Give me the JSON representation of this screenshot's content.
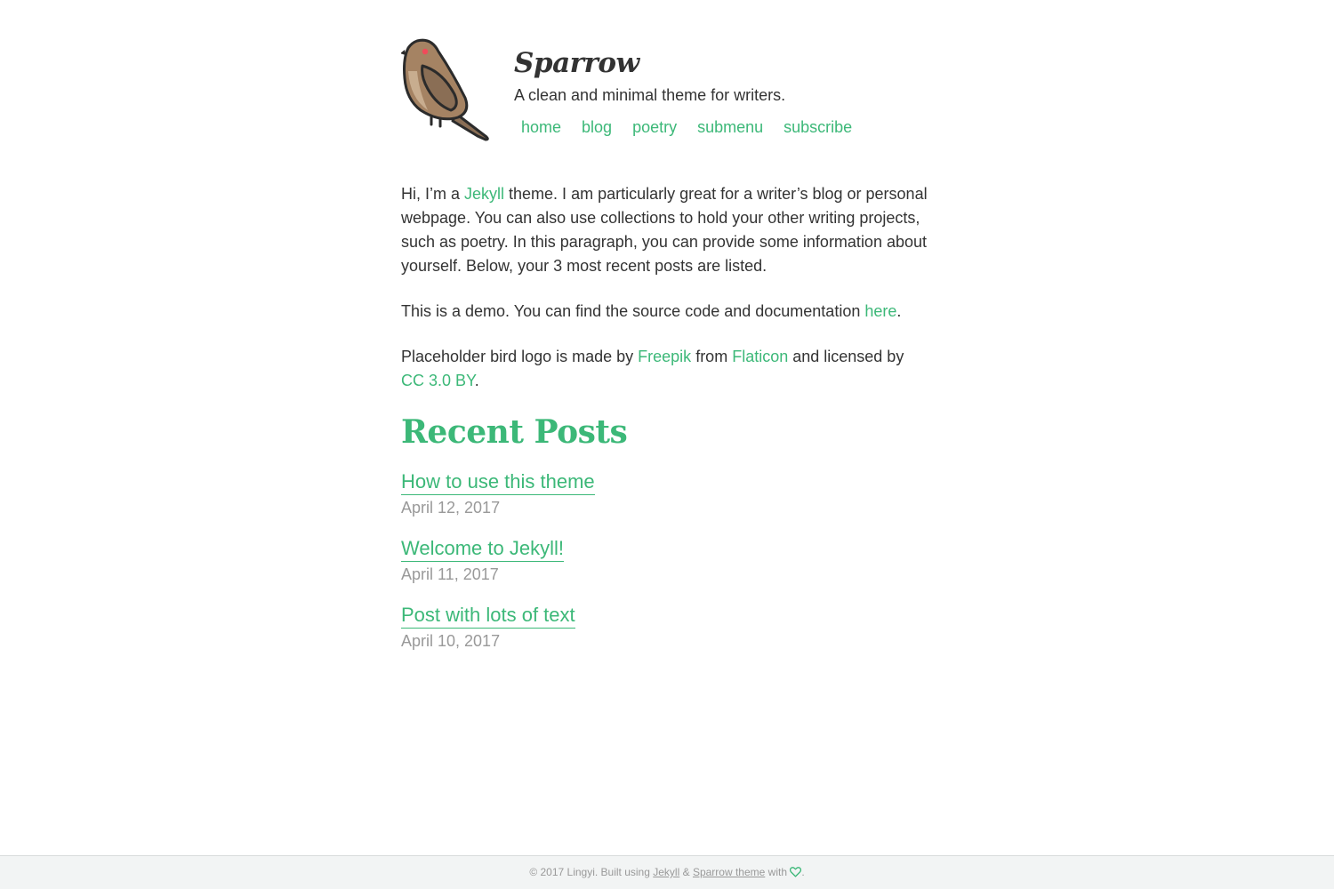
{
  "header": {
    "title": "Sparrow",
    "description": "A clean and minimal theme for writers.",
    "logo_icon": "sparrow-bird-icon",
    "nav": [
      {
        "label": "home"
      },
      {
        "label": "blog"
      },
      {
        "label": "poetry"
      },
      {
        "label": "submenu"
      },
      {
        "label": "subscribe"
      }
    ]
  },
  "intro": {
    "p1_pre": "Hi, I’m a ",
    "p1_link": "Jekyll",
    "p1_post": " theme. I am particularly great for a writer’s blog or personal webpage. You can also use collections to hold your other writing projects, such as poetry. In this paragraph, you can provide some information about yourself. Below, your 3 most recent posts are listed.",
    "p2_pre": "This is a demo. You can find the source code and documentation ",
    "p2_link": "here",
    "p2_post": ".",
    "p3_pre": "Placeholder bird logo is made by ",
    "p3_link1": "Freepik",
    "p3_mid1": " from ",
    "p3_link2": "Flaticon",
    "p3_mid2": " and licensed by ",
    "p3_link3": "CC 3.0 BY",
    "p3_post": "."
  },
  "recent": {
    "heading": "Recent Posts",
    "posts": [
      {
        "title": "How to use this theme",
        "date": "April 12, 2017"
      },
      {
        "title": "Welcome to Jekyll!",
        "date": "April 11, 2017"
      },
      {
        "title": "Post with lots of text",
        "date": "April 10, 2017"
      }
    ]
  },
  "footer": {
    "pre": "© 2017 Lingyi. Built using ",
    "link1": "Jekyll",
    "mid": " & ",
    "link2": "Sparrow theme",
    "post": " with ",
    "heart_icon": "heart-icon",
    "end": "."
  },
  "colors": {
    "accent": "#3cb878",
    "text": "#333333",
    "muted": "#999999",
    "footer_bg": "#f2f4f4"
  }
}
